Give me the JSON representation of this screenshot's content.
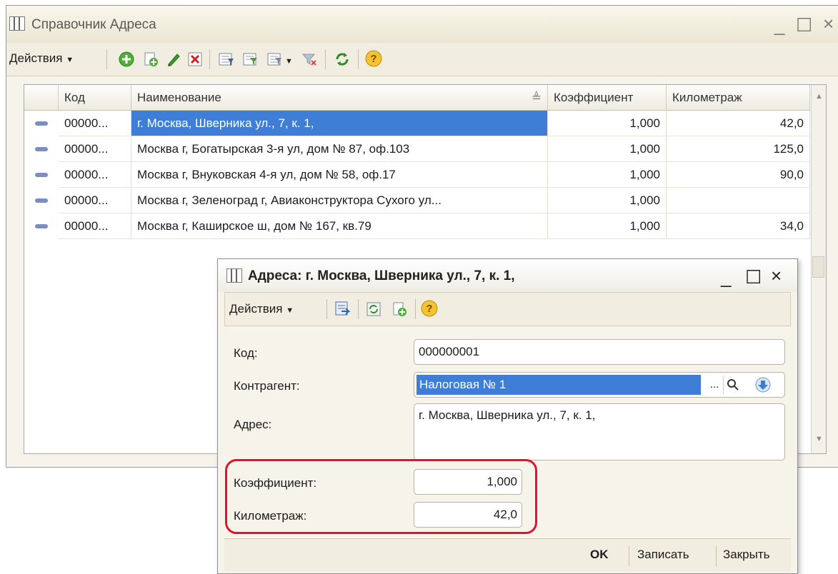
{
  "main_window": {
    "title": "Справочник Адреса",
    "minimize_glyph": "_",
    "maximize_glyph": "☐",
    "close_glyph": "×",
    "toolbar": {
      "actions_label": "Действия",
      "icons": [
        "add-icon",
        "copy-icon",
        "edit-icon",
        "delete-icon",
        "filter-icon",
        "filter-by-value-icon",
        "filter-history-icon",
        "clear-filter-icon",
        "refresh-icon",
        "help-icon"
      ]
    }
  },
  "grid": {
    "columns": [
      "Код",
      "Наименование",
      "Коэффициент",
      "Километраж"
    ],
    "rows": [
      {
        "code": "00000...",
        "name": "г. Москва, Шверника ул., 7, к. 1,",
        "coef": "1,000",
        "km": "42,0",
        "selected": true
      },
      {
        "code": "00000...",
        "name": "Москва г, Богатырская 3-я ул, дом № 87, оф.103",
        "coef": "1,000",
        "km": "125,0"
      },
      {
        "code": "00000...",
        "name": "Москва г, Внуковская 4-я ул, дом № 58, оф.17",
        "coef": "1,000",
        "km": "90,0"
      },
      {
        "code": "00000...",
        "name": "Москва г, Зеленоград г, Авиаконструктора Сухого ул...",
        "coef": "1,000",
        "km": ""
      },
      {
        "code": "00000...",
        "name": "Москва г, Каширское ш, дом № 167, кв.79",
        "coef": "1,000",
        "km": "34,0"
      }
    ]
  },
  "dialog": {
    "title": "Адреса: г. Москва, Шверника ул., 7, к. 1,",
    "toolbar": {
      "actions_label": "Действия",
      "icons": [
        "save-close-icon",
        "reread-icon",
        "copy-icon",
        "help-icon"
      ]
    },
    "fields": {
      "code_label": "Код:",
      "code_value": "000000001",
      "counterparty_label": "Контрагент:",
      "counterparty_value": "Налоговая № 1",
      "address_label": "Адрес:",
      "address_value": "г. Москва, Шверника ул., 7, к. 1,",
      "coef_label": "Коэффициент:",
      "coef_value": "1,000",
      "km_label": "Километраж:",
      "km_value": "42,0"
    },
    "select_button_glyph": "...",
    "footer": {
      "ok_label": "OK",
      "save_label": "Записать",
      "close_label": "Закрыть"
    }
  },
  "colors": {
    "selection": "#3f7ed6",
    "highlight_border": "#e0142a",
    "window_bg": "#f5f3ea"
  }
}
